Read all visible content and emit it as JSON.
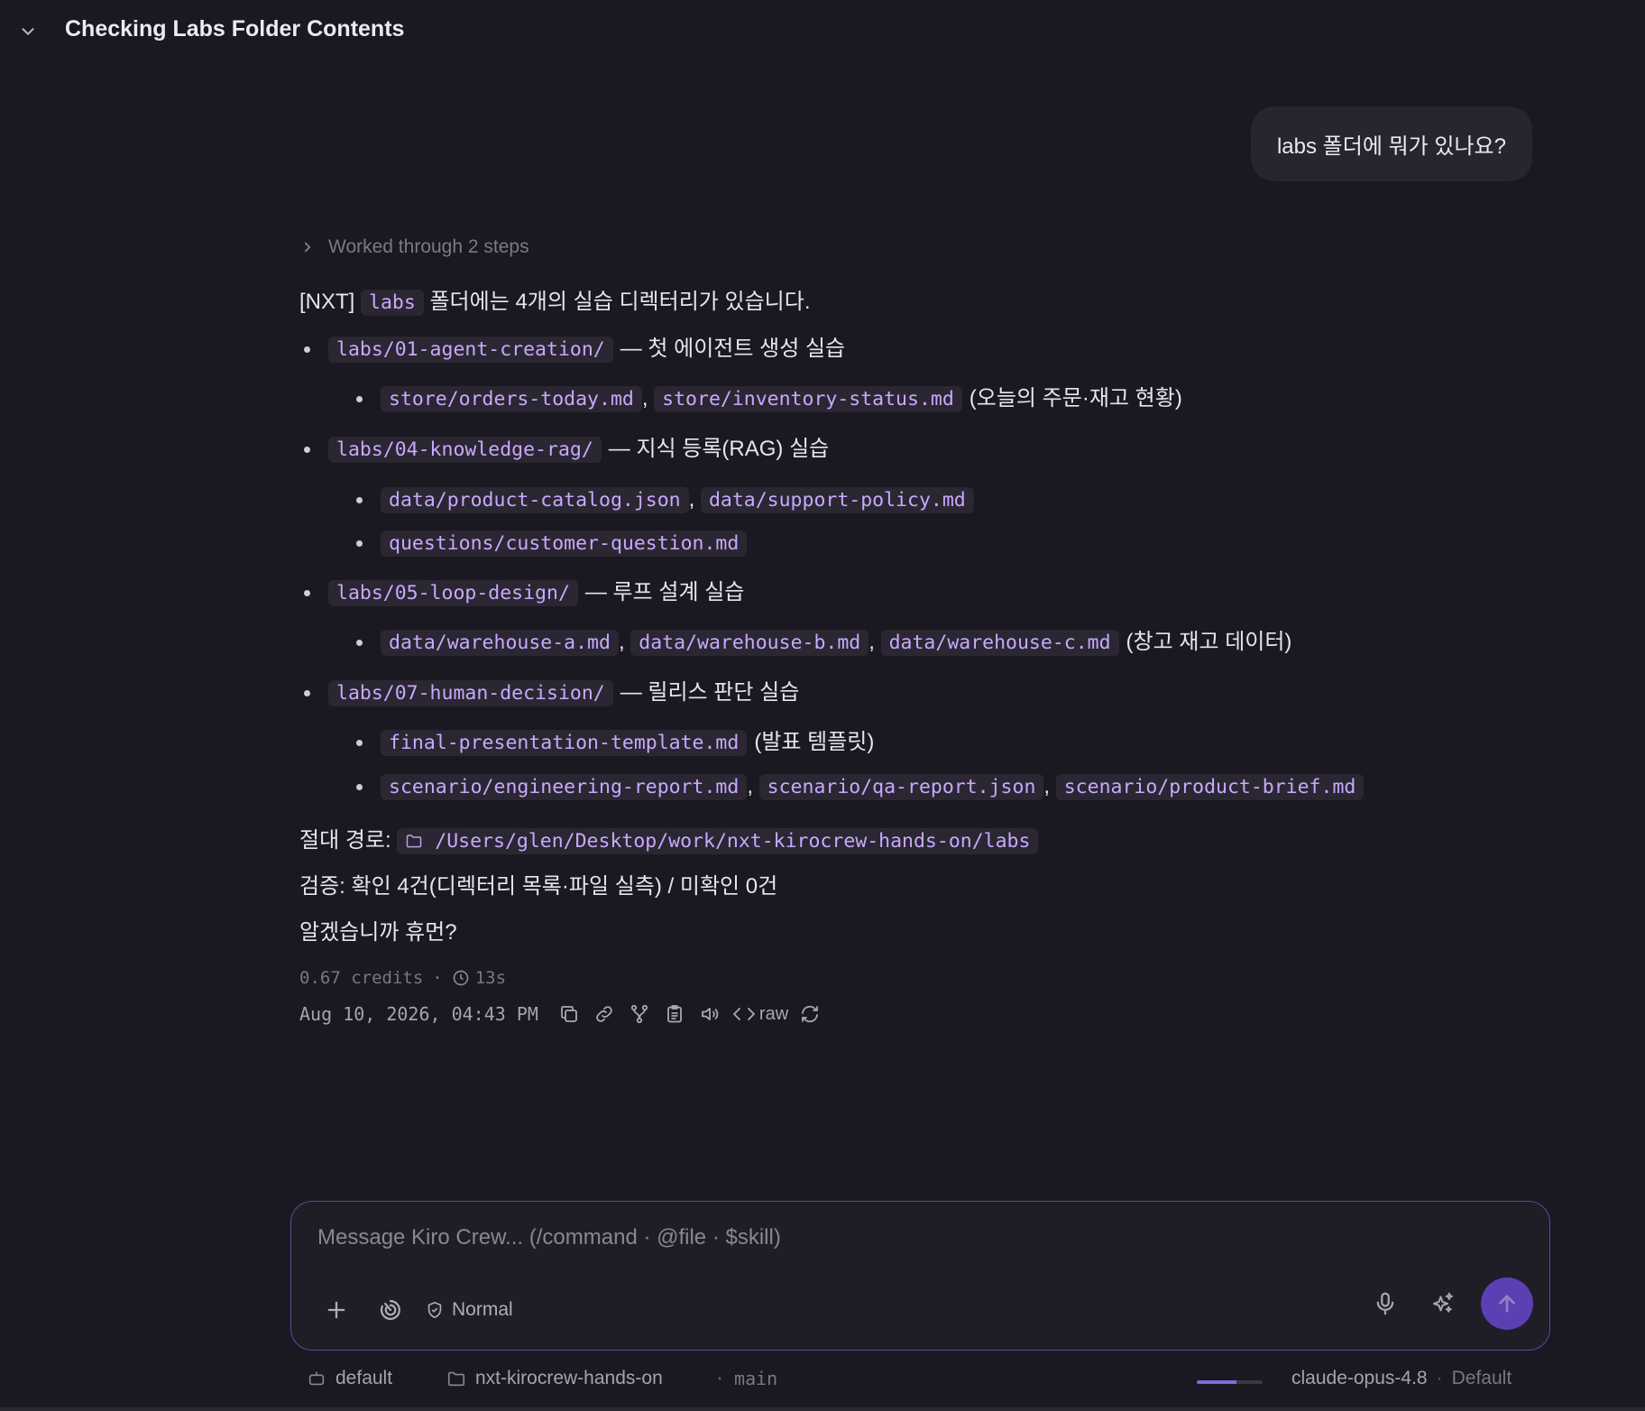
{
  "header": {
    "title": "Checking Labs Folder Contents"
  },
  "user_message": "labs 폴더에 뭐가 있나요?",
  "worked": "Worked through 2 steps",
  "intro": {
    "prefix": "[NXT]",
    "code": "labs",
    "suffix": "폴더에는 4개의 실습 디렉터리가 있습니다."
  },
  "labs": [
    {
      "dir": "labs/01-agent-creation/",
      "desc": "— 첫 에이전트 생성 실습",
      "sub": [
        {
          "files": [
            "store/orders-today.md",
            "store/inventory-status.md"
          ],
          "note": "(오늘의 주문·재고 현황)"
        }
      ]
    },
    {
      "dir": "labs/04-knowledge-rag/",
      "desc": "— 지식 등록(RAG) 실습",
      "sub": [
        {
          "files": [
            "data/product-catalog.json",
            "data/support-policy.md"
          ],
          "note": ""
        },
        {
          "files": [
            "questions/customer-question.md"
          ],
          "note": ""
        }
      ]
    },
    {
      "dir": "labs/05-loop-design/",
      "desc": "— 루프 설계 실습",
      "sub": [
        {
          "files": [
            "data/warehouse-a.md",
            "data/warehouse-b.md",
            "data/warehouse-c.md"
          ],
          "note": "(창고 재고 데이터)"
        }
      ]
    },
    {
      "dir": "labs/07-human-decision/",
      "desc": "— 릴리스 판단 실습",
      "sub": [
        {
          "files": [
            "final-presentation-template.md"
          ],
          "note": "(발표 템플릿)"
        },
        {
          "files": [
            "scenario/engineering-report.md",
            "scenario/qa-report.json",
            "scenario/product-brief.md"
          ],
          "note": ""
        }
      ]
    }
  ],
  "abs_path": {
    "label": "절대 경로:",
    "path": "/Users/glen/Desktop/work/nxt-kirocrew-hands-on/labs"
  },
  "verify": "검증: 확인 4건(디렉터리 목록·파일 실측) / 미확인 0건",
  "closing": "알겠습니까 휴먼?",
  "meta": {
    "credits": "0.67 credits",
    "sep": "·",
    "duration": "13s",
    "timestamp": "Aug 10, 2026, 04:43 PM",
    "raw_label": "raw"
  },
  "composer": {
    "placeholder": "Message Kiro Crew... (/command · @file · $skill)",
    "mode": "Normal"
  },
  "footer": {
    "agent": "default",
    "folder": "nxt-kirocrew-hands-on",
    "branch_sep": "·",
    "branch": "main",
    "model": "claude-opus-4.8",
    "model_sep": "·",
    "profile": "Default",
    "context_fill": 0.6
  },
  "colors": {
    "accent": "#5a40b3",
    "code_text": "#c9a8ff",
    "code_bg": "#2a2732",
    "bg": "#1a1820"
  }
}
